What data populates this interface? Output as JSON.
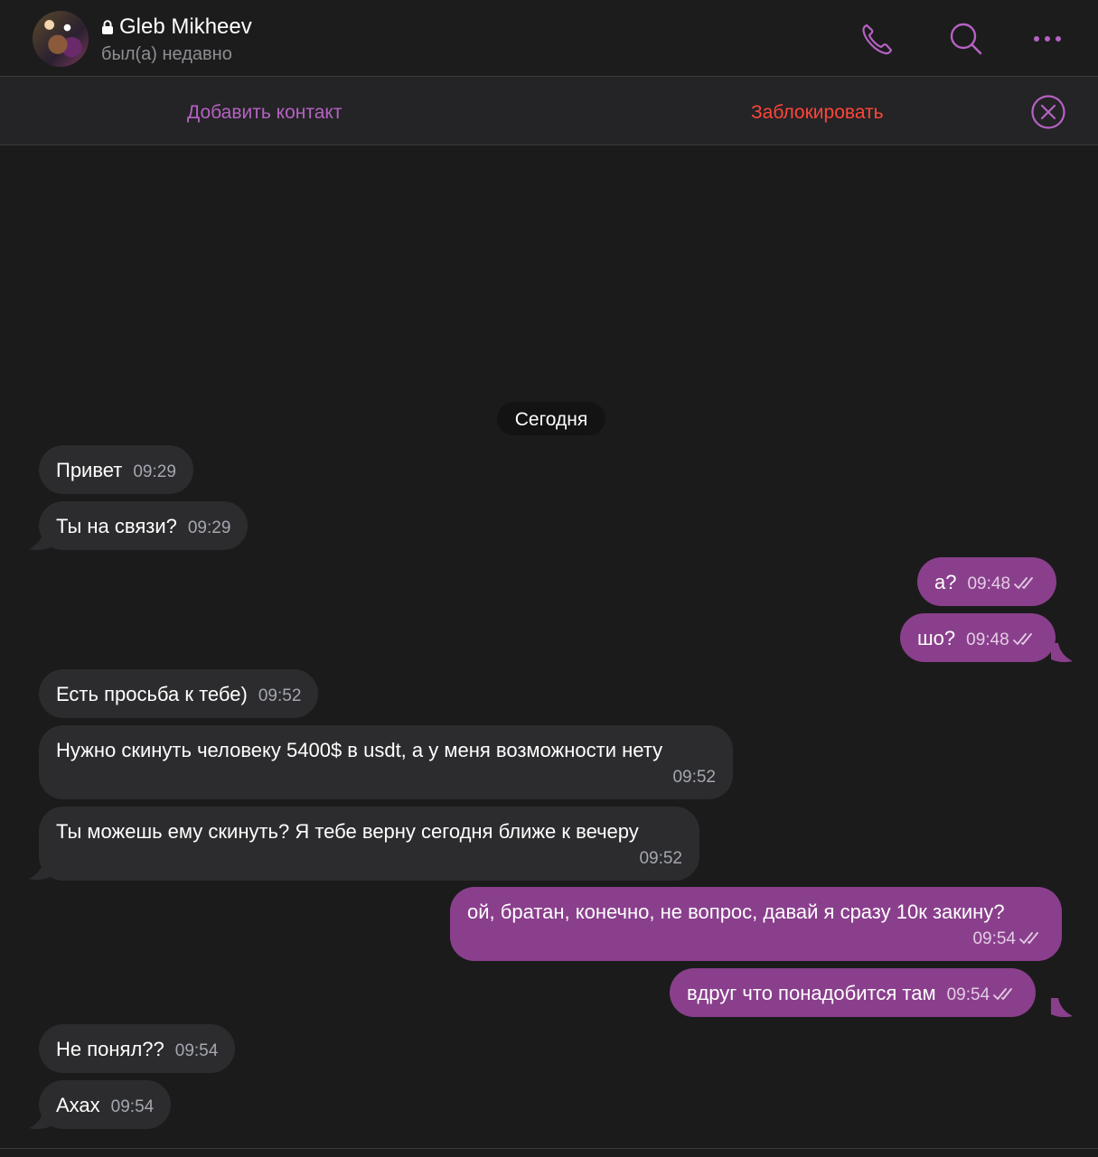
{
  "header": {
    "contact_name": "Gleb Mikheev",
    "status": "был(а) недавно",
    "icons": [
      "phone-icon",
      "search-icon",
      "more-icon"
    ]
  },
  "action_bar": {
    "add_contact": "Добавить контакт",
    "block": "Заблокировать"
  },
  "colors": {
    "accent": "#b562c2",
    "danger": "#ff453a",
    "outgoing_bubble": "#8a3f8c",
    "incoming_bubble": "#2c2c2e",
    "background": "#1b1b1b"
  },
  "chat": {
    "date_separator": "Сегодня",
    "messages": [
      {
        "direction": "in",
        "text": "Привет",
        "time": "09:29"
      },
      {
        "direction": "in",
        "text": "Ты на связи?",
        "time": "09:29"
      },
      {
        "direction": "out",
        "text": "а?",
        "time": "09:48",
        "read": true
      },
      {
        "direction": "out",
        "text": "шо?",
        "time": "09:48",
        "read": true
      },
      {
        "direction": "in",
        "text": "Есть просьба к тебе)",
        "time": "09:52"
      },
      {
        "direction": "in",
        "text": "Нужно скинуть человеку 5400$ в usdt, а у меня возможности нету",
        "time": "09:52"
      },
      {
        "direction": "in",
        "text": "Ты можешь ему скинуть? Я тебе верну сегодня ближе к вечеру",
        "time": "09:52"
      },
      {
        "direction": "out",
        "text": "ой, братан, конечно, не вопрос, давай я сразу 10к закину?",
        "time": "09:54",
        "read": true
      },
      {
        "direction": "out",
        "text": "вдруг что понадобится там",
        "time": "09:54",
        "read": true
      },
      {
        "direction": "in",
        "text": "Не понял??",
        "time": "09:54"
      },
      {
        "direction": "in",
        "text": "Ахах",
        "time": "09:54"
      }
    ]
  }
}
